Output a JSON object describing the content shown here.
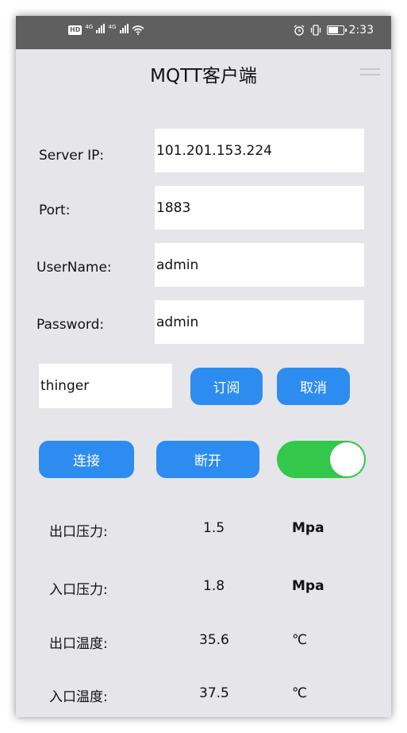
{
  "status_bar": {
    "hd_badge": "HD",
    "sim1": "4G",
    "sim2": "4G",
    "time": "2:33"
  },
  "app": {
    "title": "MQTT客户端"
  },
  "form": {
    "server_ip": {
      "label": "Server IP:",
      "value": "101.201.153.224"
    },
    "port": {
      "label": "Port:",
      "value": "1883"
    },
    "username": {
      "label": "UserName:",
      "value": "admin"
    },
    "password": {
      "label": "Password:",
      "value": "admin"
    }
  },
  "subscribe": {
    "topic_value": "thinger",
    "subscribe_label": "订阅",
    "cancel_label": "取消"
  },
  "connection": {
    "connect_label": "连接",
    "disconnect_label": "断开",
    "toggle_on": true
  },
  "readings": [
    {
      "label": "出口压力:",
      "value": "1.5",
      "unit": "Mpa"
    },
    {
      "label": "入口压力:",
      "value": "1.8",
      "unit": "Mpa"
    },
    {
      "label": "出口温度:",
      "value": "35.6",
      "unit": "℃"
    },
    {
      "label": "入口温度:",
      "value": "37.5",
      "unit": "℃"
    }
  ],
  "colors": {
    "accent": "#2d8cf0",
    "toggle_on": "#34c84a",
    "background": "#e5e5ea",
    "status_bar": "#5f5f5f"
  }
}
